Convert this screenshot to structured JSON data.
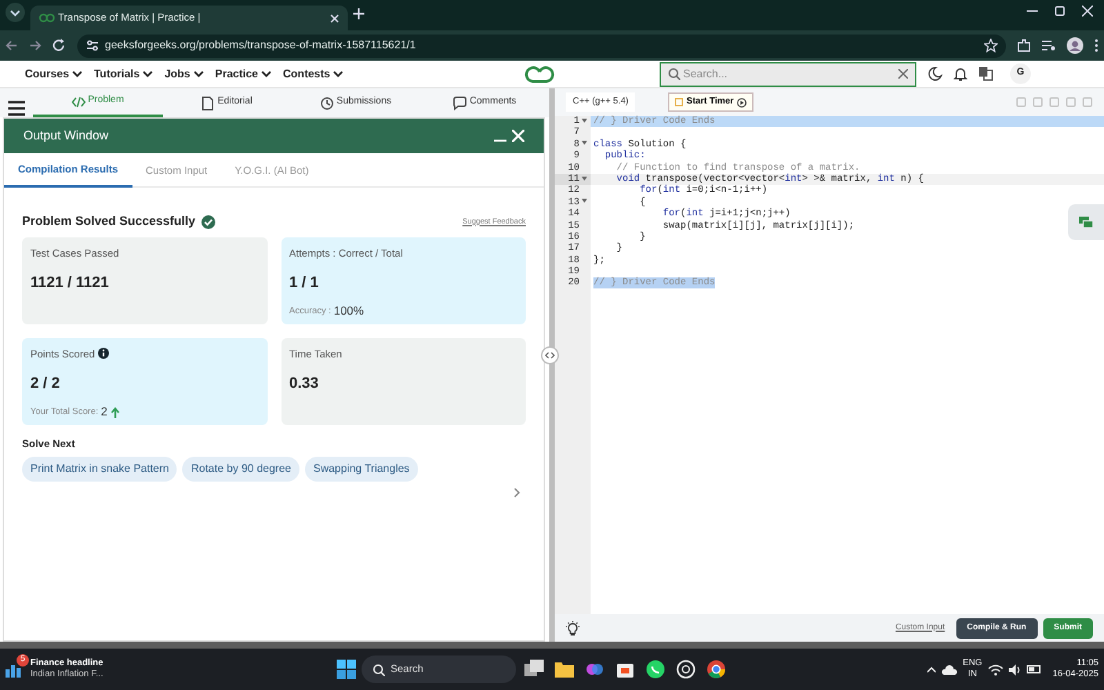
{
  "browser": {
    "tab_title": "Transpose of Matrix | Practice |",
    "url": "geeksforgeeks.org/problems/transpose-of-matrix-1587115621/1"
  },
  "site_nav": {
    "menus": [
      "Courses",
      "Tutorials",
      "Jobs",
      "Practice",
      "Contests"
    ],
    "search": {
      "placeholder": "Search..."
    },
    "avatar": "G"
  },
  "problem_tabs": [
    {
      "label": "Problem",
      "selected": true
    },
    {
      "label": "Editorial",
      "selected": false
    },
    {
      "label": "Submissions",
      "selected": false
    },
    {
      "label": "Comments",
      "selected": false
    }
  ],
  "output_window": {
    "title": "Output Window",
    "tabs": [
      {
        "label": "Compilation Results",
        "selected": true
      },
      {
        "label": "Custom Input",
        "selected": false
      },
      {
        "label": "Y.O.G.I. (AI Bot)",
        "selected": false
      }
    ],
    "status": "Problem Solved Successfully",
    "feedback_link": "Suggest Feedback",
    "stats": [
      {
        "label": "Test Cases Passed",
        "value": "1121 / 1121",
        "highlighted": false,
        "info": false,
        "trend_up": false
      },
      {
        "label": "Attempts : Correct / Total",
        "value": "1 / 1",
        "highlighted": true,
        "info": false,
        "trend_up": false,
        "note_label": "Accuracy :",
        "note_value": "100%"
      },
      {
        "label": "Points Scored",
        "value": "2 / 2",
        "highlighted": true,
        "info": true,
        "trend_up": true,
        "note_label": "Your Total Score:",
        "note_value": "2"
      },
      {
        "label": "Time Taken",
        "value": "0.33",
        "highlighted": false,
        "info": false,
        "trend_up": false
      }
    ],
    "solve_next": {
      "title": "Solve Next",
      "items": [
        "Print Matrix in snake Pattern",
        "Rotate by 90 degree",
        "Swapping Triangles"
      ]
    }
  },
  "editor": {
    "language": "C++ (g++ 5.4)",
    "timer_button": "Start Timer",
    "lines": [
      {
        "number": "1",
        "fold": true,
        "active": false,
        "selected": true,
        "to_line_end": true,
        "tokens": [
          {
            "text": "// } Driver Code Ends",
            "kind": "comment"
          }
        ]
      },
      {
        "number": "7",
        "fold": false,
        "active": false,
        "selected": false
      },
      {
        "number": "8",
        "fold": true,
        "active": false,
        "selected": false,
        "tokens": [
          {
            "text": "class",
            "kind": "kw"
          },
          {
            "text": " Solution {",
            "kind": "plain"
          }
        ]
      },
      {
        "number": "9",
        "fold": false,
        "active": false,
        "selected": false,
        "tokens": [
          {
            "text": "  public:",
            "kind": "kw"
          }
        ]
      },
      {
        "number": "10",
        "fold": false,
        "active": false,
        "selected": false,
        "tokens": [
          {
            "text": "    // Function to find transpose of a matrix.",
            "kind": "comment"
          }
        ]
      },
      {
        "number": "11",
        "fold": true,
        "active": true,
        "selected": false,
        "tokens": [
          {
            "text": "    void",
            "kind": "kw"
          },
          {
            "text": " transpose(vector<vector<",
            "kind": "plain"
          },
          {
            "text": "int",
            "kind": "kw"
          },
          {
            "text": "> >& matrix, ",
            "kind": "plain"
          },
          {
            "text": "int",
            "kind": "kw"
          },
          {
            "text": " n) {",
            "kind": "plain"
          }
        ]
      },
      {
        "number": "12",
        "fold": false,
        "active": false,
        "selected": false,
        "tokens": [
          {
            "text": "        for",
            "kind": "kw"
          },
          {
            "text": "(",
            "kind": "plain"
          },
          {
            "text": "int",
            "kind": "kw"
          },
          {
            "text": " i=0;i<n-1;i++)",
            "kind": "plain"
          }
        ]
      },
      {
        "number": "13",
        "fold": true,
        "active": false,
        "selected": false,
        "tokens": [
          {
            "text": "        {",
            "kind": "plain"
          }
        ]
      },
      {
        "number": "14",
        "fold": false,
        "active": false,
        "selected": false,
        "tokens": [
          {
            "text": "            for",
            "kind": "kw"
          },
          {
            "text": "(",
            "kind": "plain"
          },
          {
            "text": "int",
            "kind": "kw"
          },
          {
            "text": " j=i+1;j<n;j++)",
            "kind": "plain"
          }
        ]
      },
      {
        "number": "15",
        "fold": false,
        "active": false,
        "selected": false,
        "tokens": [
          {
            "text": "            swap(matrix[i][j], matrix[j][i]);",
            "kind": "plain"
          }
        ]
      },
      {
        "number": "16",
        "fold": false,
        "active": false,
        "selected": false,
        "tokens": [
          {
            "text": "        }",
            "kind": "plain"
          }
        ]
      },
      {
        "number": "17",
        "fold": false,
        "active": false,
        "selected": false,
        "tokens": [
          {
            "text": "    }",
            "kind": "plain"
          }
        ]
      },
      {
        "number": "18",
        "fold": false,
        "active": false,
        "selected": false,
        "tokens": [
          {
            "text": "};",
            "kind": "plain"
          }
        ]
      },
      {
        "number": "19",
        "fold": false,
        "active": false,
        "selected": false
      },
      {
        "number": "20",
        "fold": false,
        "active": false,
        "selected": true,
        "to_line_end": false,
        "tokens": [
          {
            "text": "// } Driver Code Ends",
            "kind": "comment"
          }
        ]
      }
    ],
    "footer": {
      "link": "Custom Input",
      "buttons": [
        "Compile & Run",
        "Submit"
      ]
    }
  },
  "taskbar": {
    "news_badge": "5",
    "news_title": "Finance headline",
    "news_text": "Indian Inflation F...",
    "search": "Search",
    "language": "ENG",
    "region": "IN",
    "time": "11:05",
    "date": "16-04-2025"
  }
}
